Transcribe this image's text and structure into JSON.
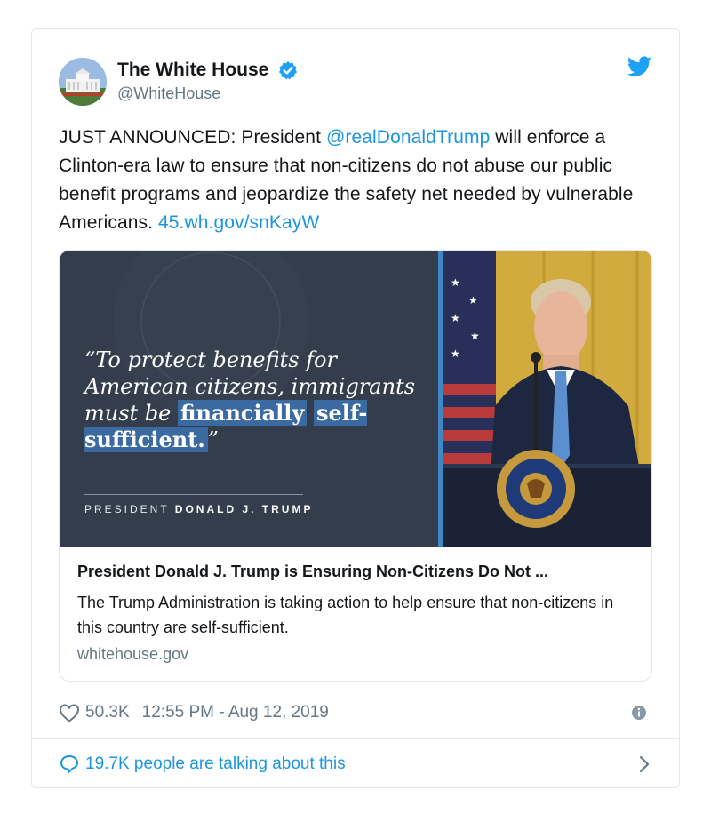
{
  "account": {
    "name": "The White House",
    "handle": "@WhiteHouse",
    "verified": true
  },
  "tweet": {
    "text_before": "JUST ANNOUNCED: President ",
    "mention": "@realDonaldTrump",
    "text_after": " will enforce a Clinton-era law to ensure that non-citizens do not abuse our public benefit programs and jeopardize the safety net needed by vulnerable Americans. ",
    "link": "45.wh.gov/snKayW"
  },
  "card": {
    "quote_open": "“To protect benefits for American citizens, immigrants must be ",
    "quote_highlight_1": "financially",
    "quote_highlight_2": "self-sufficient.",
    "quote_close": "”",
    "byline_prefix": "PRESIDENT ",
    "byline_name": "DONALD J. TRUMP",
    "title": "President Donald J. Trump is Ensuring Non-Citizens Do Not ...",
    "description": "The Trump Administration is taking action to help ensure that non-citizens in this country are self-sufficient.",
    "domain": "whitehouse.gov"
  },
  "meta": {
    "likes": "50.3K",
    "timestamp": "12:55 PM - Aug 12, 2019"
  },
  "footer": {
    "talking": "19.7K people are talking about this"
  },
  "colors": {
    "link": "#1b95e0",
    "secondary_text": "#657786",
    "quote_panel_bg": "#333d4b",
    "verified_badge": "#1da1f2"
  },
  "icons": {
    "verified": "verified-badge-icon",
    "bird": "twitter-bird-icon",
    "heart": "heart-icon",
    "info": "info-icon",
    "bubble": "speech-bubble-icon",
    "chevron": "chevron-right-icon"
  }
}
